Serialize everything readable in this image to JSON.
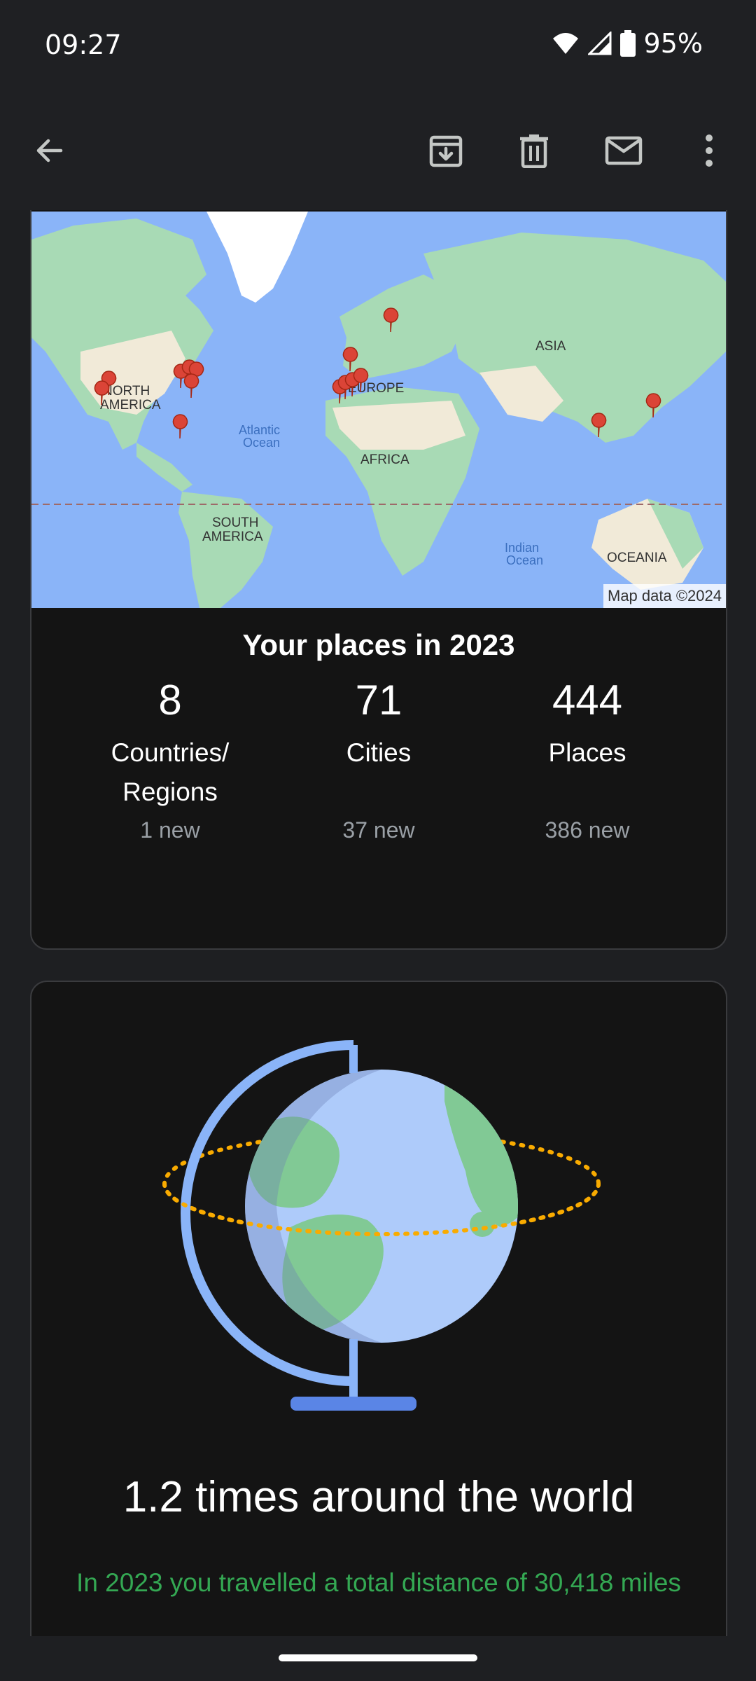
{
  "status_bar": {
    "time": "09:27",
    "battery": "95%",
    "icons": [
      "wifi-icon",
      "signal-icon",
      "battery-icon"
    ]
  },
  "app_bar": {
    "icons": [
      "back-arrow-icon",
      "archive-icon",
      "delete-icon",
      "mark-unread-icon",
      "more-vert-icon"
    ]
  },
  "map": {
    "labels": {
      "north_america_1": "NORTH",
      "north_america_2": "AMERICA",
      "europe": "EUROPE",
      "asia": "ASIA",
      "africa": "AFRICA",
      "south_america_1": "SOUTH",
      "south_america_2": "AMERICA",
      "oceania": "OCEANIA",
      "atlantic_1": "Atlantic",
      "atlantic_2": "Ocean",
      "indian_1": "Indian",
      "indian_2": "Ocean"
    },
    "credit": "Map data ©2024",
    "marker_color": "#db4437"
  },
  "places_summary": {
    "title": "Your places in 2023",
    "stats": [
      {
        "value": "8",
        "label_line1": "Countries/",
        "label_line2": "Regions",
        "new": "1 new"
      },
      {
        "value": "71",
        "label_line1": "Cities",
        "label_line2": "",
        "new": "37 new"
      },
      {
        "value": "444",
        "label_line1": "Places",
        "label_line2": "",
        "new": "386 new"
      }
    ]
  },
  "travel": {
    "title": "1.2 times around the world",
    "subtitle": "In 2023 you travelled a total distance of 30,418 miles"
  },
  "colors": {
    "background": "#1e1f22",
    "card": "#141414",
    "accent_green": "#34a853",
    "globe_blue": "#aecbfa",
    "globe_land": "#81c995",
    "orbit": "#f9ab00"
  }
}
